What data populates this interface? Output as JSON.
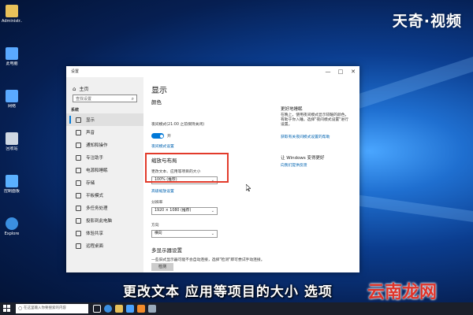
{
  "brand_logo": "天奇·视频",
  "desktop_icons": [
    {
      "label": "Administr...",
      "icon": "folder-user-icon",
      "color": "#e8c15a"
    },
    {
      "label": "此电脑",
      "icon": "computer-icon",
      "color": "#5aa9ff"
    },
    {
      "label": "网络",
      "icon": "network-icon",
      "color": "#5aa9ff"
    },
    {
      "label": "回收站",
      "icon": "recycle-bin-icon",
      "color": "#cfd8e3"
    },
    {
      "label": "控制面板",
      "icon": "control-panel-icon",
      "color": "#5ab0ff"
    },
    {
      "label": "Explore",
      "icon": "ie-icon",
      "color": "#3b8fe0"
    }
  ],
  "window": {
    "title": "设置",
    "buttons": {
      "minimize": "—",
      "maximize": "□",
      "close": "✕"
    },
    "nav": {
      "home": "主页",
      "search_placeholder": "查找设置",
      "section": "系统",
      "items": [
        {
          "label": "显示",
          "active": true
        },
        {
          "label": "声音",
          "active": false
        },
        {
          "label": "通知和操作",
          "active": false
        },
        {
          "label": "专注助手",
          "active": false
        },
        {
          "label": "电源和睡眠",
          "active": false
        },
        {
          "label": "存储",
          "active": false
        },
        {
          "label": "平板模式",
          "active": false
        },
        {
          "label": "多任务处理",
          "active": false
        },
        {
          "label": "投影到此电脑",
          "active": false
        },
        {
          "label": "体验共享",
          "active": false
        },
        {
          "label": "远程桌面",
          "active": false
        }
      ]
    },
    "content": {
      "title": "显示",
      "color_heading": "颜色",
      "night_light_desc": "夜间模式(21:00 之前保持关闭)",
      "toggle_state": "开",
      "night_light_link": "夜间模式设置",
      "scale_heading": "缩放与布局",
      "scale_label": "更改文本、应用等项目的大小",
      "scale_value": "100% (推荐)",
      "advanced_link": "高级缩放设置",
      "resolution_label": "分辨率",
      "resolution_value": "1920 × 1080 (推荐)",
      "orientation_label": "方向",
      "orientation_value": "横向",
      "multi_heading": "多显示器设置",
      "multi_desc_1": "一些旧式显示器可能不会自动连接，选择\"检测\"即可尝试手动连接。",
      "detect_button": "检测"
    },
    "right_panel": {
      "sleep_title": "更好地睡眠",
      "sleep_desc": "在晚上，使用夜间模式显示较暖的颜色，有助于你入睡。选择\"夜间模式设置\"进行设置。",
      "sleep_link": "获取有关夜间模式设置的帮助",
      "windows_title": "让 Windows 变得更好",
      "windows_link": "向我们提供反馈"
    }
  },
  "caption": "更改文本 应用等项目的大小 选项",
  "watermark": "云南龙网",
  "taskbar": {
    "search_placeholder": "在这里输入你要搜索的内容",
    "apps": [
      {
        "icon": "task-view-icon",
        "color": "#ffffff"
      },
      {
        "icon": "ie-icon",
        "color": "#3b8fe0"
      },
      {
        "icon": "file-explorer-icon",
        "color": "#e8c15a"
      },
      {
        "icon": "store-icon",
        "color": "#4aa3ff"
      },
      {
        "icon": "app-orange-icon",
        "color": "#f28b2b"
      },
      {
        "icon": "settings-icon",
        "color": "#9ab"
      }
    ]
  }
}
